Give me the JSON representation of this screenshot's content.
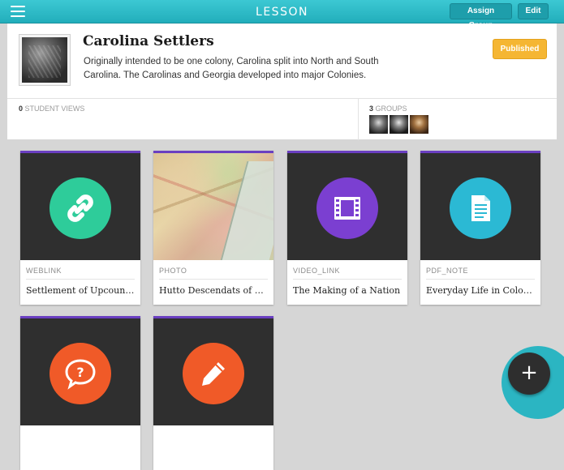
{
  "topbar": {
    "title": "LESSON",
    "assign_label": "Assign Group",
    "edit_label": "Edit",
    "menu_icon": "menu-icon"
  },
  "lesson": {
    "title": "Carolina Settlers",
    "description": "Originally intended to be one colony, Carolina split into North and South Carolina. The Carolinas and Georgia developed into major Colonies.",
    "status": "Published"
  },
  "stats": {
    "views_count": "0",
    "views_label": "STUDENT VIEWS",
    "groups_count": "3",
    "groups_label": "GROUPS"
  },
  "cards": [
    {
      "type": "WEBLINK",
      "title": "Settlement of Upcount…",
      "icon": "link-icon",
      "color": "#2ecc9a"
    },
    {
      "type": "PHOTO",
      "title": "Hutto Descendats of A…",
      "icon": "map-image"
    },
    {
      "type": "VIDEO_LINK",
      "title": "The Making of a Nation",
      "icon": "film-icon",
      "color": "#7b3fd1"
    },
    {
      "type": "PDF_NOTE",
      "title": "Everyday Life in Colon…",
      "icon": "document-icon",
      "color": "#2bb9d4"
    },
    {
      "type": "",
      "title": "",
      "icon": "question-icon",
      "color": "#f05a28"
    },
    {
      "type": "",
      "title": "",
      "icon": "pencil-icon",
      "color": "#f05a28"
    }
  ],
  "colors": {
    "accent": "#22aebb",
    "card_stripe": "#6a3fc1",
    "published": "#f5b633"
  },
  "fab_label": "+"
}
